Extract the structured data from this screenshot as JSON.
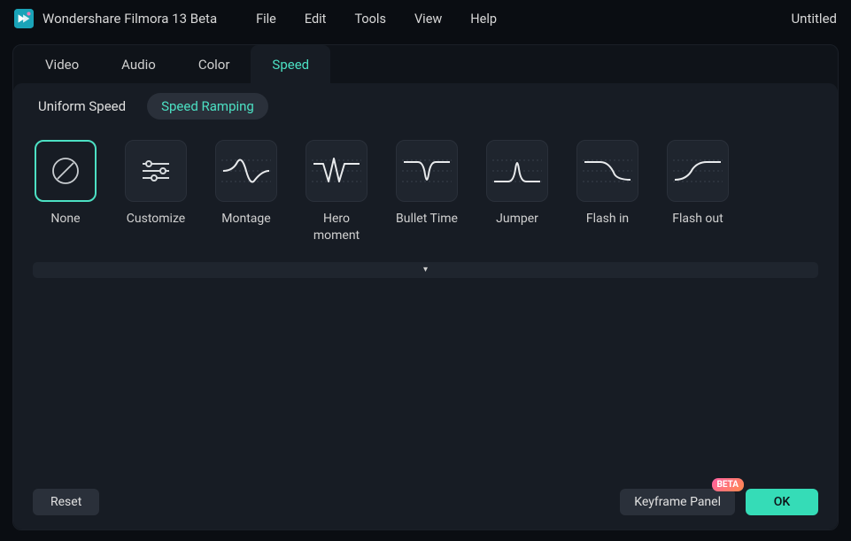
{
  "app": {
    "title": "Wondershare Filmora 13 Beta",
    "project_title": "Untitled"
  },
  "menu": {
    "file": "File",
    "edit": "Edit",
    "tools": "Tools",
    "view": "View",
    "help": "Help"
  },
  "tabs": {
    "video": "Video",
    "audio": "Audio",
    "color": "Color",
    "speed": "Speed",
    "active": "speed"
  },
  "sub_tabs": {
    "uniform": "Uniform Speed",
    "ramping": "Speed Ramping",
    "active": "ramping"
  },
  "presets": [
    {
      "id": "none",
      "label": "None",
      "selected": true
    },
    {
      "id": "customize",
      "label": "Customize",
      "selected": false
    },
    {
      "id": "montage",
      "label": "Montage",
      "selected": false
    },
    {
      "id": "hero",
      "label": "Hero moment",
      "selected": false
    },
    {
      "id": "bullet",
      "label": "Bullet Time",
      "selected": false
    },
    {
      "id": "jumper",
      "label": "Jumper",
      "selected": false
    },
    {
      "id": "flashin",
      "label": "Flash in",
      "selected": false
    },
    {
      "id": "flashout",
      "label": "Flash out",
      "selected": false
    }
  ],
  "buttons": {
    "reset": "Reset",
    "keyframe": "Keyframe Panel",
    "beta_badge": "BETA",
    "ok": "OK"
  },
  "colors": {
    "accent": "#4ce0c3"
  }
}
